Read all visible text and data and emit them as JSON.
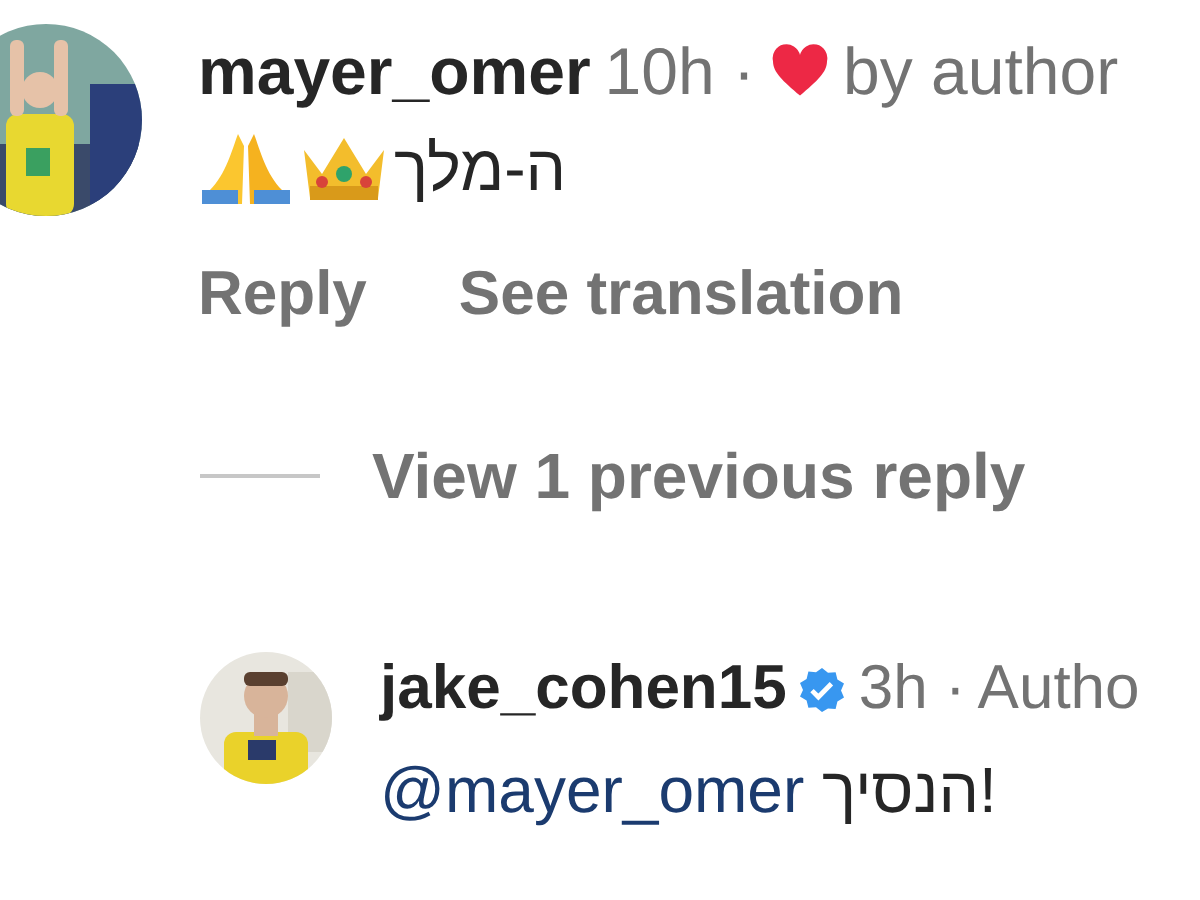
{
  "comments": [
    {
      "kind": "comment",
      "username": "mayer_omer",
      "verified": false,
      "time": "10h",
      "separator": "·",
      "liked_by_author": true,
      "liked_label": "by author",
      "text": "ה-מלך",
      "actions": [
        "Reply",
        "See translation"
      ]
    },
    {
      "kind": "reply",
      "username": "jake_cohen15",
      "verified": true,
      "time": "3h",
      "separator": "·",
      "author_label": "Autho",
      "mention": "@mayer_omer",
      "text": "הנסיך!"
    }
  ],
  "view_replies": "View 1 previous reply"
}
